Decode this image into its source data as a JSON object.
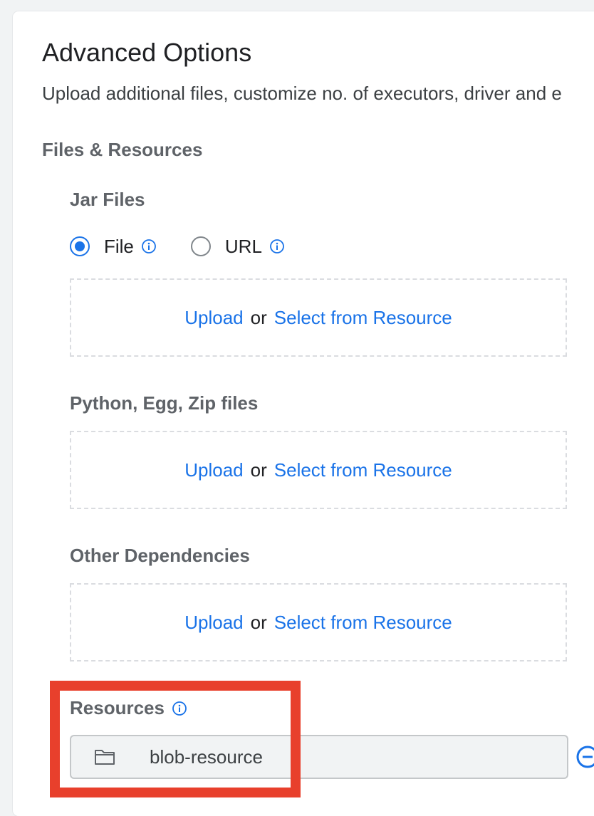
{
  "header": {
    "title": "Advanced Options",
    "subtitle": "Upload additional files, customize no. of executors, driver and e"
  },
  "files_resources": {
    "section_title": "Files & Resources",
    "jar_files": {
      "label": "Jar Files",
      "options": [
        {
          "label": "File",
          "selected": true
        },
        {
          "label": "URL",
          "selected": false
        }
      ]
    },
    "dropzones": [
      {
        "upload_label": "Upload",
        "or_label": "or",
        "select_label": "Select from Resource"
      },
      {
        "upload_label": "Upload",
        "or_label": "or",
        "select_label": "Select from Resource"
      },
      {
        "upload_label": "Upload",
        "or_label": "or",
        "select_label": "Select from Resource"
      }
    ],
    "python_label": "Python, Egg, Zip files",
    "other_label": "Other Dependencies"
  },
  "resources": {
    "label": "Resources",
    "value": "blob-resource"
  },
  "colors": {
    "accent": "#1a73e8",
    "highlight": "#e8402c",
    "label_gray": "#5f6368"
  }
}
